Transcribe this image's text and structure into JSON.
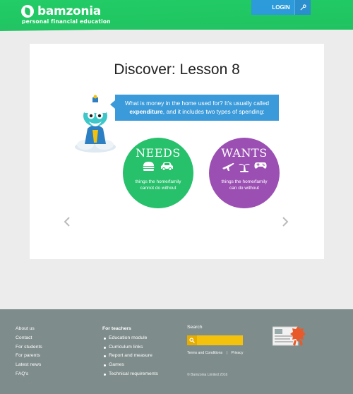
{
  "header": {
    "brand": "bamzonia",
    "tagline": "personal financial education",
    "login_label": "LOGIN",
    "colors": {
      "green": "#22c463",
      "blue": "#2d9ad9"
    }
  },
  "lesson": {
    "title": "Discover: Lesson 8",
    "speech_before": "What is money in the home used for? It's usually called",
    "speech_bold": "expenditure",
    "speech_after": ", and it includes two types of spending:",
    "needs": {
      "title": "NEEDS",
      "description": "things the home/family cannot do without",
      "icons": [
        "burger-icon",
        "car-icon"
      ],
      "color": "#27c06b"
    },
    "wants": {
      "title": "WANTS",
      "description": "things the home/family can do without",
      "icons": [
        "airplane-icon",
        "palm-tree-icon",
        "gamepad-icon"
      ],
      "color": "#9b4fb3"
    }
  },
  "footer": {
    "col1": [
      "About us",
      "Contact",
      "For students",
      "For parents",
      "Latest news",
      "FAQ's"
    ],
    "col2_heading": "For teachers",
    "col2": [
      "Education module",
      "Curriculum links",
      "Report and measure",
      "Games",
      "Technical requirements"
    ],
    "search_label": "Search",
    "search_placeholder": "",
    "terms": "Terms and Conditions",
    "privacy": "Privacy",
    "separator": "|",
    "copyright": "© Bamzonia Limited 2016",
    "badge_label": "QUALITY MARK"
  }
}
